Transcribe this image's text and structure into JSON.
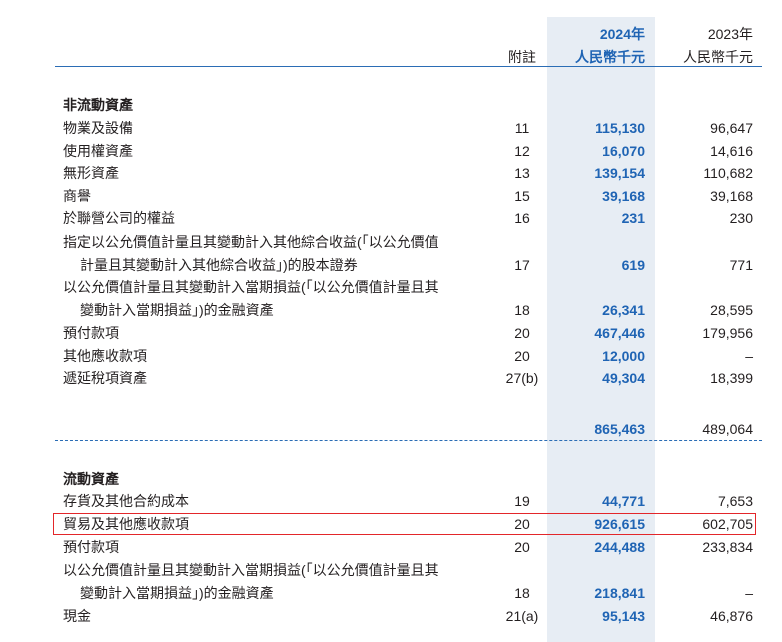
{
  "header": {
    "note_label": "附註",
    "year_current": "2024年",
    "year_prior": "2023年",
    "unit_current": "人民幣千元",
    "unit_prior": "人民幣千元"
  },
  "noncurrent": {
    "title": "非流動資產",
    "rows": [
      {
        "label": "物業及設備",
        "note": "11",
        "v2024": "115,130",
        "v2023": "96,647"
      },
      {
        "label": "使用權資產",
        "note": "12",
        "v2024": "16,070",
        "v2023": "14,616"
      },
      {
        "label": "無形資產",
        "note": "13",
        "v2024": "139,154",
        "v2023": "110,682"
      },
      {
        "label": "商譽",
        "note": "15",
        "v2024": "39,168",
        "v2023": "39,168"
      },
      {
        "label": "於聯營公司的權益",
        "note": "16",
        "v2024": "231",
        "v2023": "230"
      },
      {
        "label": "指定以公允價值計量且其變動計入其他綜合收益(「以公允價值",
        "label2": "計量且其變動計入其他綜合收益」)的股本證券",
        "note": "17",
        "v2024": "619",
        "v2023": "771"
      },
      {
        "label": "以公允價值計量且其變動計入當期損益(「以公允價值計量且其",
        "label2": "變動計入當期損益」)的金融資產",
        "note": "18",
        "v2024": "26,341",
        "v2023": "28,595"
      },
      {
        "label": "預付款項",
        "note": "20",
        "v2024": "467,446",
        "v2023": "179,956"
      },
      {
        "label": "其他應收款項",
        "note": "20",
        "v2024": "12,000",
        "v2023": "–"
      },
      {
        "label": "遞延稅項資產",
        "note": "27(b)",
        "v2024": "49,304",
        "v2023": "18,399"
      }
    ],
    "total_2024": "865,463",
    "total_2023": "489,064"
  },
  "current": {
    "title": "流動資產",
    "rows": [
      {
        "label": "存貨及其他合約成本",
        "note": "19",
        "v2024": "44,771",
        "v2023": "7,653"
      },
      {
        "label": "貿易及其他應收款項",
        "note": "20",
        "v2024": "926,615",
        "v2023": "602,705"
      },
      {
        "label": "預付款項",
        "note": "20",
        "v2024": "244,488",
        "v2023": "233,834"
      },
      {
        "label": "以公允價值計量且其變動計入當期損益(「以公允價值計量且其",
        "label2": "變動計入當期損益」)的金融資產",
        "note": "18",
        "v2024": "218,841",
        "v2023": "–"
      },
      {
        "label": "現金",
        "note": "21(a)",
        "v2024": "95,143",
        "v2023": "46,876"
      }
    ]
  },
  "colors": {
    "accent": "#1f64b4",
    "highlight": "#e3262a",
    "shade": "#e7edf4"
  }
}
